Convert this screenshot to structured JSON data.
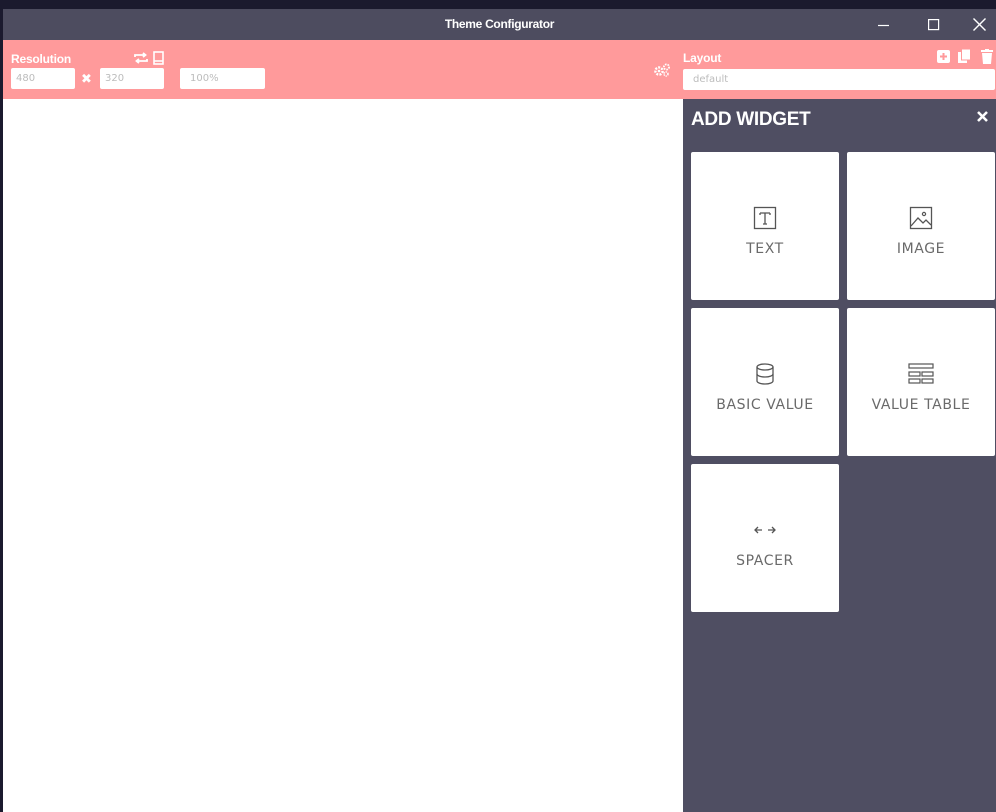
{
  "window": {
    "title": "Theme Configurator"
  },
  "toolbar": {
    "resolution_label": "Resolution",
    "width_value": "480",
    "height_value": "320",
    "multiply_sign": "✖",
    "zoom_value": "100%",
    "layout_label": "Layout",
    "layout_value": "default"
  },
  "panel": {
    "title": "ADD WIDGET",
    "widgets": [
      {
        "label": "TEXT",
        "icon": "text-icon"
      },
      {
        "label": "IMAGE",
        "icon": "image-icon"
      },
      {
        "label": "BASIC VALUE",
        "icon": "database-icon"
      },
      {
        "label": "VALUE TABLE",
        "icon": "table-icon"
      },
      {
        "label": "SPACER",
        "icon": "arrows-horizontal-icon"
      }
    ]
  },
  "colors": {
    "toolbar": "#ff9a9b",
    "panel": "#4f4e62",
    "titlebar": "#4d4c5f"
  }
}
